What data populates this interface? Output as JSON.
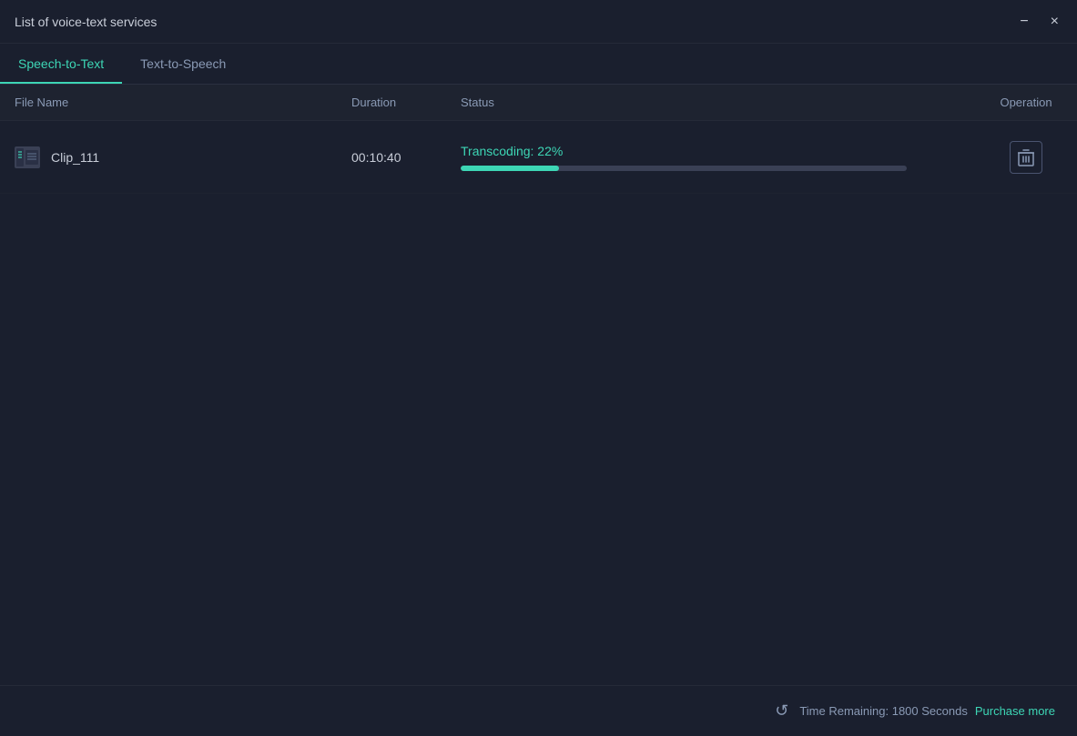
{
  "window": {
    "title": "List of voice-text services",
    "minimize_label": "−",
    "close_label": "×"
  },
  "tabs": [
    {
      "id": "speech-to-text",
      "label": "Speech-to-Text",
      "active": true
    },
    {
      "id": "text-to-speech",
      "label": "Text-to-Speech",
      "active": false
    }
  ],
  "table": {
    "columns": {
      "filename": "File Name",
      "duration": "Duration",
      "status": "Status",
      "operation": "Operation"
    },
    "rows": [
      {
        "id": "row-1",
        "filename": "Clip_111",
        "duration": "00:10:40",
        "status_label": "Transcoding:  22%",
        "progress_percent": 22,
        "has_icon": true
      }
    ]
  },
  "footer": {
    "time_remaining_text": "Time Remaining: 1800 Seconds",
    "purchase_link": "Purchase more"
  },
  "colors": {
    "accent": "#3dd6b5",
    "bg": "#1a1f2e",
    "progress_track": "#3a4055"
  }
}
